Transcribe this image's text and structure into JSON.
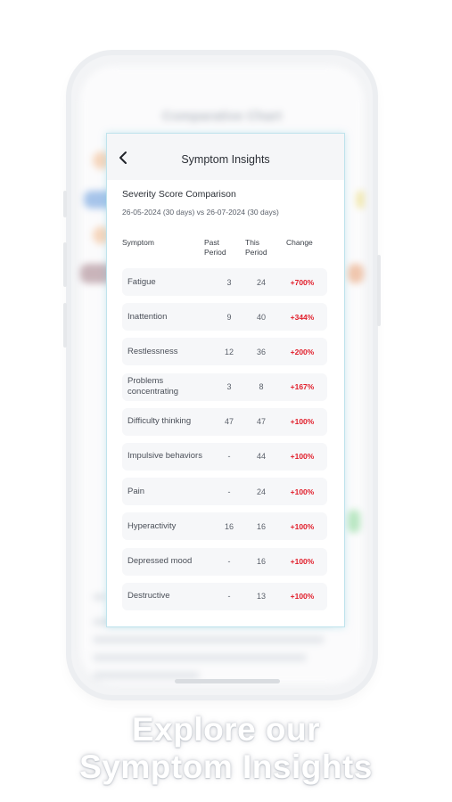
{
  "background": {
    "blurred_title": "Comparative Chart",
    "colors": {
      "peach": "#f6d6bd",
      "blue": "#a6c4ea",
      "mauve": "#c9b4ba",
      "green": "#b9e7c2"
    }
  },
  "card": {
    "title": "Symptom Insights",
    "back_icon": "chevron-left-icon",
    "section_title": "Severity Score Comparison",
    "date_range": "26-05-2024 (30 days) vs 26-07-2024 (30 days)",
    "columns": {
      "symptom": "Symptom",
      "past": "Past\nPeriod",
      "this": "This\nPeriod",
      "change": "Change"
    },
    "rows": [
      {
        "symptom": "Fatigue",
        "past": "3",
        "this": "24",
        "change": "+700%"
      },
      {
        "symptom": "Inattention",
        "past": "9",
        "this": "40",
        "change": "+344%"
      },
      {
        "symptom": "Restlessness",
        "past": "12",
        "this": "36",
        "change": "+200%"
      },
      {
        "symptom": "Problems concentrating",
        "past": "3",
        "this": "8",
        "change": "+167%"
      },
      {
        "symptom": "Difficulty thinking",
        "past": "47",
        "this": "47",
        "change": "+100%"
      },
      {
        "symptom": "Impulsive behaviors",
        "past": "-",
        "this": "44",
        "change": "+100%"
      },
      {
        "symptom": "Pain",
        "past": "-",
        "this": "24",
        "change": "+100%"
      },
      {
        "symptom": "Hyperactivity",
        "past": "16",
        "this": "16",
        "change": "+100%"
      },
      {
        "symptom": "Depressed mood",
        "past": "-",
        "this": "16",
        "change": "+100%"
      },
      {
        "symptom": "Destructive",
        "past": "-",
        "this": "13",
        "change": "+100%"
      }
    ],
    "change_color": "#e11d2a"
  },
  "caption": {
    "line1": "Explore our",
    "line2": "Symptom Insights"
  }
}
